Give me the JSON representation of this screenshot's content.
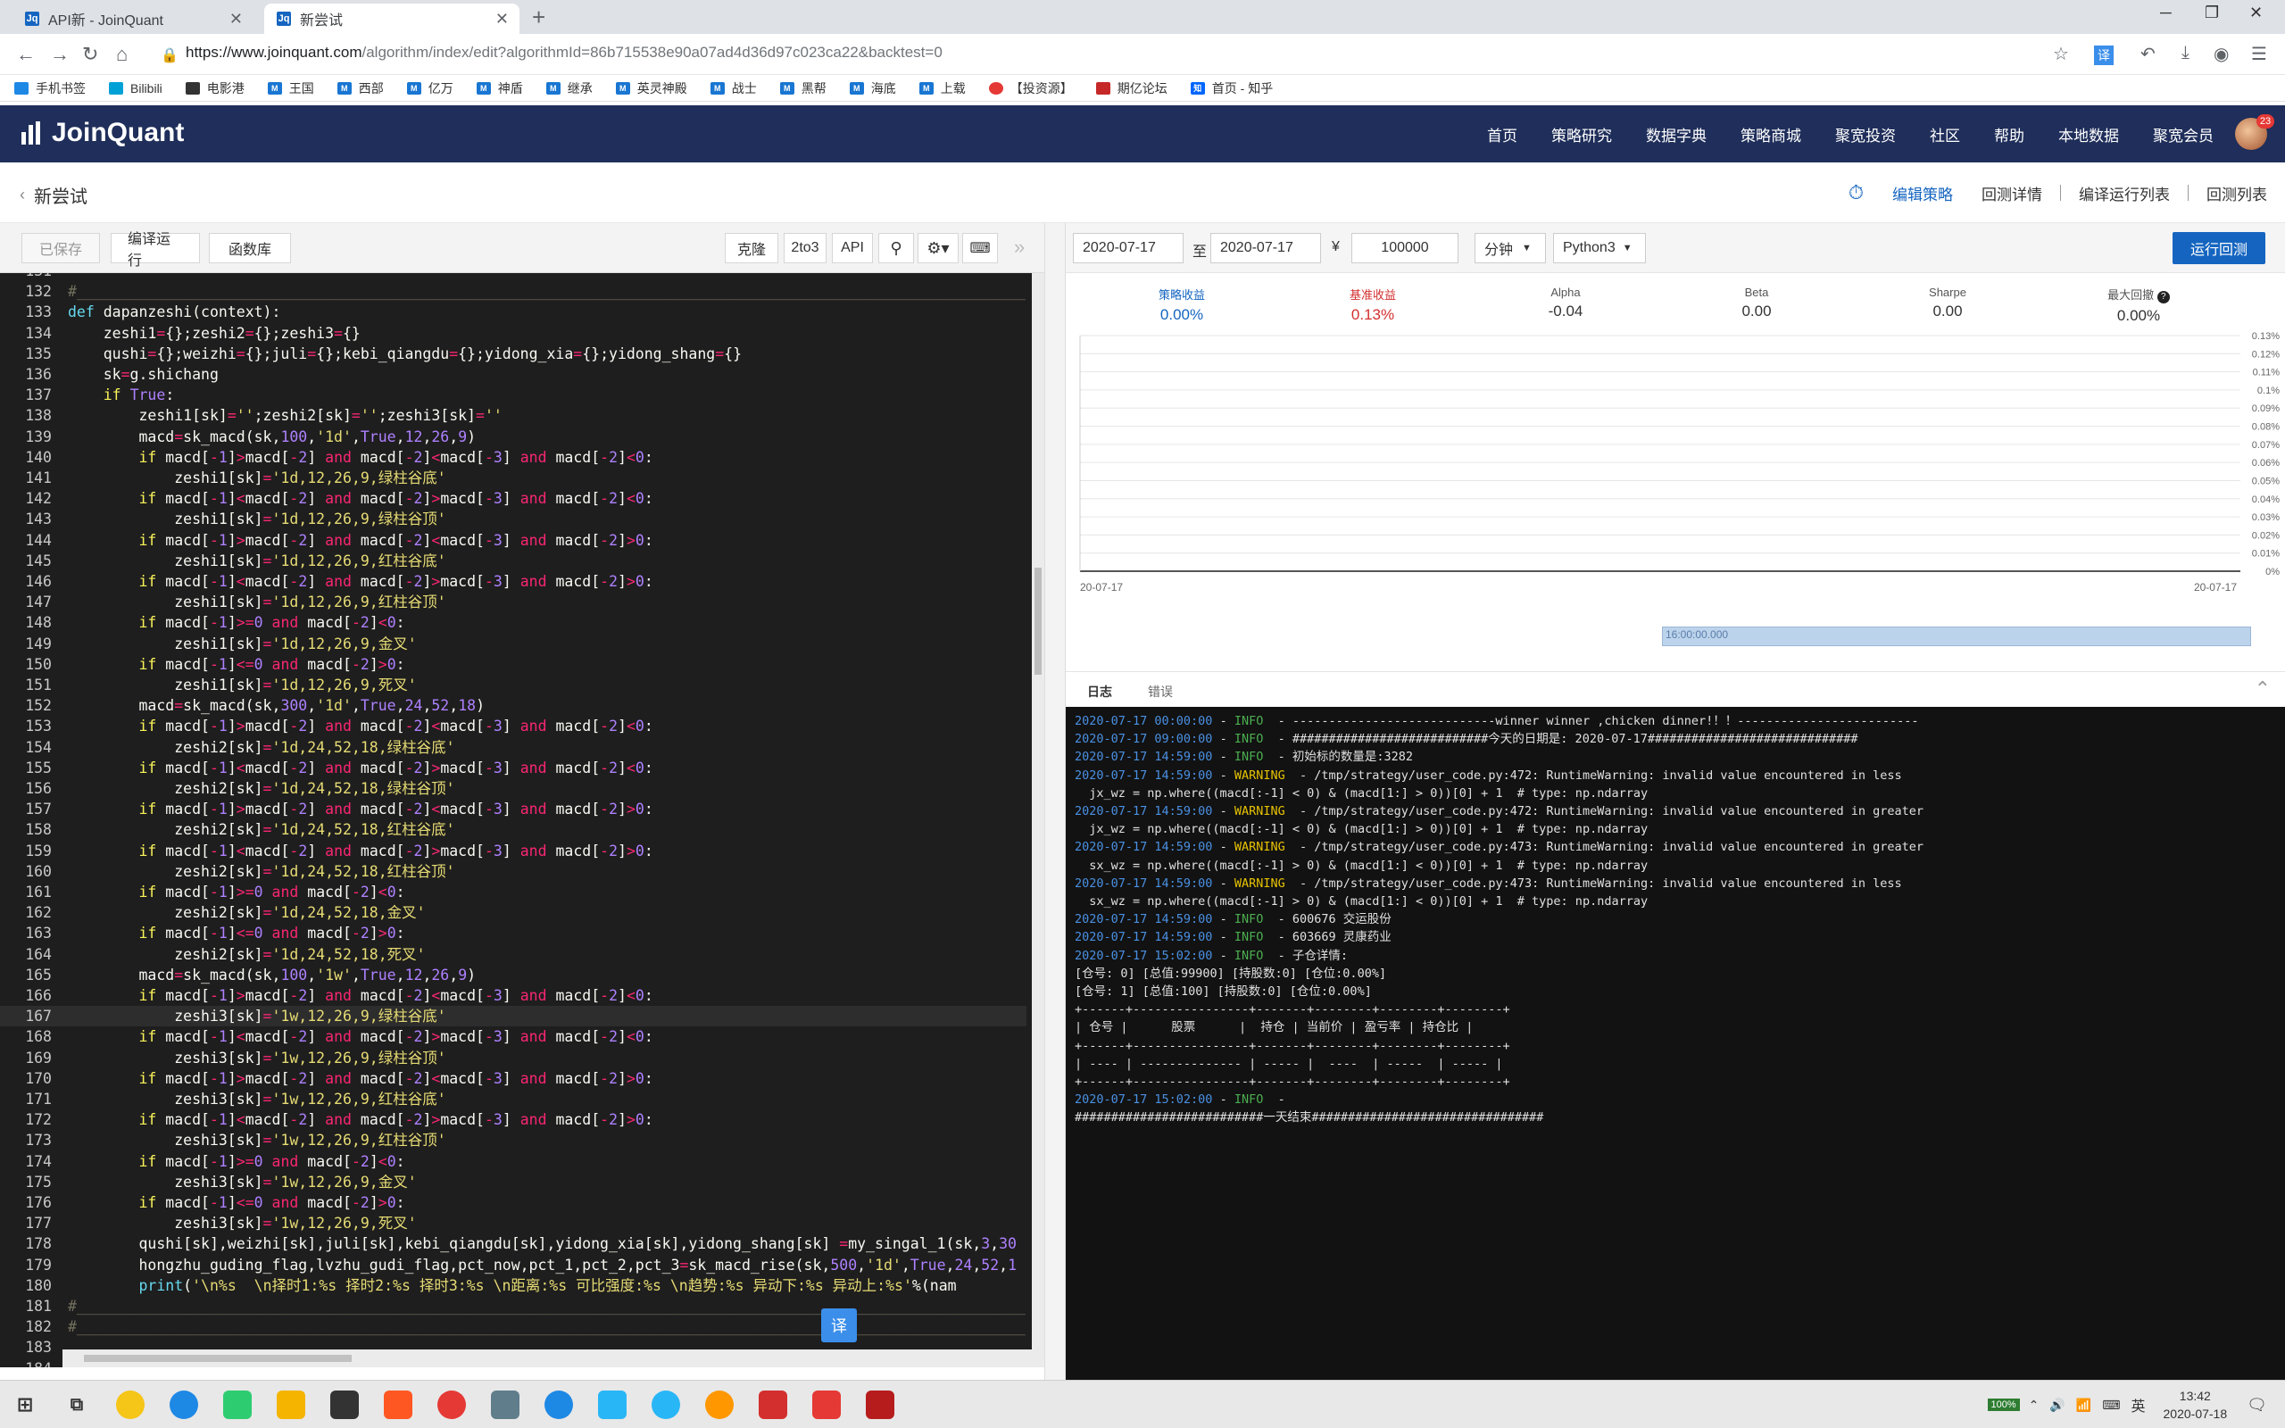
{
  "browser": {
    "tabs": [
      {
        "title": "API新 - JoinQuant",
        "favicon": "jq-icon",
        "active": false
      },
      {
        "title": "新尝试",
        "favicon": "jq-icon",
        "active": true
      }
    ],
    "url_host": "https://www.joinquant.com",
    "url_path": "/algorithm/index/edit?algorithmId=86b715538e90a07ad4d36d97c023ca22&backtest=0",
    "translate_label": "译",
    "bookmarks": [
      "手机书签",
      "Bilibili",
      "电影港",
      "王国",
      "西部",
      "亿万",
      "神盾",
      "继承",
      "英灵神殿",
      "战士",
      "黑帮",
      "海底",
      "上载",
      "【投资源】",
      "期亿论坛",
      "首页 - 知乎"
    ]
  },
  "site": {
    "brand": "JoinQuant",
    "nav": [
      "首页",
      "策略研究",
      "数据字典",
      "策略商城",
      "聚宽投资",
      "社区",
      "帮助",
      "本地数据",
      "聚宽会员"
    ],
    "avatar_badge": "23"
  },
  "strategy": {
    "name": "新尝试",
    "tabs": [
      {
        "label": "编辑策略",
        "active": true
      },
      {
        "label": "回测详情",
        "active": false
      },
      {
        "label": "编译运行列表",
        "active": false
      },
      {
        "label": "回测列表",
        "active": false
      }
    ]
  },
  "editor": {
    "toolbar": {
      "saved": "已保存",
      "compile_run": "编译运行",
      "function_lib": "函数库",
      "clone": "克隆",
      "to3": "2to3",
      "api": "API"
    },
    "current_line": 167,
    "translate_bubble": "译",
    "lines": [
      {
        "n": "131",
        "t": ""
      },
      {
        "n": "132",
        "t": "#___________________________________________________________________________________________________________"
      },
      {
        "n": "133",
        "t": "def dapanzeshi(context):"
      },
      {
        "n": "134",
        "t": "    zeshi1={};zeshi2={};zeshi3={}"
      },
      {
        "n": "135",
        "t": "    qushi={};weizhi={};juli={};kebi_qiangdu={};yidong_xia={};yidong_shang={}"
      },
      {
        "n": "136",
        "t": "    sk=g.shichang"
      },
      {
        "n": "137",
        "t": "    if True:"
      },
      {
        "n": "138",
        "t": "        zeshi1[sk]='';zeshi2[sk]='';zeshi3[sk]=''"
      },
      {
        "n": "139",
        "t": "        macd=sk_macd(sk,100,'1d',True,12,26,9)"
      },
      {
        "n": "140",
        "t": "        if macd[-1]>macd[-2] and macd[-2]<macd[-3] and macd[-2]<0:"
      },
      {
        "n": "141",
        "t": "            zeshi1[sk]='1d,12,26,9,绿柱谷底'"
      },
      {
        "n": "142",
        "t": "        if macd[-1]<macd[-2] and macd[-2]>macd[-3] and macd[-2]<0:"
      },
      {
        "n": "143",
        "t": "            zeshi1[sk]='1d,12,26,9,绿柱谷顶'"
      },
      {
        "n": "144",
        "t": "        if macd[-1]>macd[-2] and macd[-2]<macd[-3] and macd[-2]>0:"
      },
      {
        "n": "145",
        "t": "            zeshi1[sk]='1d,12,26,9,红柱谷底'"
      },
      {
        "n": "146",
        "t": "        if macd[-1]<macd[-2] and macd[-2]>macd[-3] and macd[-2]>0:"
      },
      {
        "n": "147",
        "t": "            zeshi1[sk]='1d,12,26,9,红柱谷顶'"
      },
      {
        "n": "148",
        "t": "        if macd[-1]>=0 and macd[-2]<0:"
      },
      {
        "n": "149",
        "t": "            zeshi1[sk]='1d,12,26,9,金叉'"
      },
      {
        "n": "150",
        "t": "        if macd[-1]<=0 and macd[-2]>0:"
      },
      {
        "n": "151",
        "t": "            zeshi1[sk]='1d,12,26,9,死叉'"
      },
      {
        "n": "152",
        "t": "        macd=sk_macd(sk,300,'1d',True,24,52,18)"
      },
      {
        "n": "153",
        "t": "        if macd[-1]>macd[-2] and macd[-2]<macd[-3] and macd[-2]<0:"
      },
      {
        "n": "154",
        "t": "            zeshi2[sk]='1d,24,52,18,绿柱谷底'"
      },
      {
        "n": "155",
        "t": "        if macd[-1]<macd[-2] and macd[-2]>macd[-3] and macd[-2]<0:"
      },
      {
        "n": "156",
        "t": "            zeshi2[sk]='1d,24,52,18,绿柱谷顶'"
      },
      {
        "n": "157",
        "t": "        if macd[-1]>macd[-2] and macd[-2]<macd[-3] and macd[-2]>0:"
      },
      {
        "n": "158",
        "t": "            zeshi2[sk]='1d,24,52,18,红柱谷底'"
      },
      {
        "n": "159",
        "t": "        if macd[-1]<macd[-2] and macd[-2]>macd[-3] and macd[-2]>0:"
      },
      {
        "n": "160",
        "t": "            zeshi2[sk]='1d,24,52,18,红柱谷顶'"
      },
      {
        "n": "161",
        "t": "        if macd[-1]>=0 and macd[-2]<0:"
      },
      {
        "n": "162",
        "t": "            zeshi2[sk]='1d,24,52,18,金叉'"
      },
      {
        "n": "163",
        "t": "        if macd[-1]<=0 and macd[-2]>0:"
      },
      {
        "n": "164",
        "t": "            zeshi2[sk]='1d,24,52,18,死叉'"
      },
      {
        "n": "165",
        "t": "        macd=sk_macd(sk,100,'1w',True,12,26,9)"
      },
      {
        "n": "166",
        "t": "        if macd[-1]>macd[-2] and macd[-2]<macd[-3] and macd[-2]<0:"
      },
      {
        "n": "167",
        "t": "            zeshi3[sk]='1w,12,26,9,绿柱谷底'"
      },
      {
        "n": "168",
        "t": "        if macd[-1]<macd[-2] and macd[-2]>macd[-3] and macd[-2]<0:"
      },
      {
        "n": "169",
        "t": "            zeshi3[sk]='1w,12,26,9,绿柱谷顶'"
      },
      {
        "n": "170",
        "t": "        if macd[-1]>macd[-2] and macd[-2]<macd[-3] and macd[-2]>0:"
      },
      {
        "n": "171",
        "t": "            zeshi3[sk]='1w,12,26,9,红柱谷底'"
      },
      {
        "n": "172",
        "t": "        if macd[-1]<macd[-2] and macd[-2]>macd[-3] and macd[-2]>0:"
      },
      {
        "n": "173",
        "t": "            zeshi3[sk]='1w,12,26,9,红柱谷顶'"
      },
      {
        "n": "174",
        "t": "        if macd[-1]>=0 and macd[-2]<0:"
      },
      {
        "n": "175",
        "t": "            zeshi3[sk]='1w,12,26,9,金叉'"
      },
      {
        "n": "176",
        "t": "        if macd[-1]<=0 and macd[-2]>0:"
      },
      {
        "n": "177",
        "t": "            zeshi3[sk]='1w,12,26,9,死叉'"
      },
      {
        "n": "178",
        "t": "        qushi[sk],weizhi[sk],juli[sk],kebi_qiangdu[sk],yidong_xia[sk],yidong_shang[sk] =my_singal_1(sk,3,30"
      },
      {
        "n": "179",
        "t": "        hongzhu_guding_flag,lvzhu_gudi_flag,pct_now,pct_1,pct_2,pct_3=sk_macd_rise(sk,500,'1d',True,24,52,1"
      },
      {
        "n": "180",
        "t": "        print('\\n%s  \\n择时1:%s 择时2:%s 择时3:%s \\n距离:%s 可比强度:%s \\n趋势:%s 异动下:%s 异动上:%s'%(nam"
      },
      {
        "n": "181",
        "t": "#___________________________________________________________________________________________________________"
      },
      {
        "n": "182",
        "t": "#___________________________________________________________________________________________________________"
      },
      {
        "n": "183",
        "t": ""
      },
      {
        "n": "184",
        "t": ""
      },
      {
        "n": "185",
        "t": ""
      }
    ]
  },
  "backtest": {
    "start_date": "2020-07-17",
    "to_label": "至",
    "end_date": "2020-07-17",
    "currency": "¥",
    "capital": "100000",
    "frequency": "分钟",
    "python": "Python3",
    "run_label": "运行回测",
    "metrics": [
      {
        "label": "策略收益",
        "value": "0.00%",
        "color": "blue"
      },
      {
        "label": "基准收益",
        "value": "0.13%",
        "color": "red"
      },
      {
        "label": "Alpha",
        "value": "-0.04",
        "color": "normal"
      },
      {
        "label": "Beta",
        "value": "0.00",
        "color": "normal"
      },
      {
        "label": "Sharpe",
        "value": "0.00",
        "color": "normal"
      },
      {
        "label": "最大回撤",
        "value": "0.00%",
        "color": "normal"
      }
    ],
    "slider_label": "16:00:00.000"
  },
  "chart_data": {
    "type": "line",
    "x": [
      "20-07-17",
      "20-07-17"
    ],
    "y_ticks": [
      "0.13%",
      "0.12%",
      "0.11%",
      "0.1%",
      "0.09%",
      "0.08%",
      "0.07%",
      "0.06%",
      "0.05%",
      "0.04%",
      "0.03%",
      "0.02%",
      "0.01%",
      "0%"
    ],
    "ylim": [
      0,
      0.13
    ],
    "grid": true
  },
  "logs": {
    "tabs": [
      {
        "label": "日志",
        "active": true
      },
      {
        "label": "错误",
        "active": false
      }
    ],
    "lines": [
      {
        "ts": "2020-07-17 00:00:00",
        "lv": "INFO",
        "msg": "----------------------------winner winner ,chicken dinner!！！-------------------------"
      },
      {
        "ts": "2020-07-17 09:00:00",
        "lv": "INFO",
        "msg": "###########################今天的日期是: 2020-07-17#############################"
      },
      {
        "ts": "2020-07-17 14:59:00",
        "lv": "INFO",
        "msg": "初始标的数量是:3282"
      },
      {
        "ts": "2020-07-17 14:59:00",
        "lv": "WARNING",
        "msg": "/tmp/strategy/user_code.py:472: RuntimeWarning: invalid value encountered in less"
      },
      {
        "ts": "",
        "lv": "",
        "msg": "  jx_wz = np.where((macd[:-1] < 0) & (macd[1:] > 0))[0] + 1  # type: np.ndarray"
      },
      {
        "ts": "2020-07-17 14:59:00",
        "lv": "WARNING",
        "msg": "/tmp/strategy/user_code.py:472: RuntimeWarning: invalid value encountered in greater"
      },
      {
        "ts": "",
        "lv": "",
        "msg": "  jx_wz = np.where((macd[:-1] < 0) & (macd[1:] > 0))[0] + 1  # type: np.ndarray"
      },
      {
        "ts": "2020-07-17 14:59:00",
        "lv": "WARNING",
        "msg": "/tmp/strategy/user_code.py:473: RuntimeWarning: invalid value encountered in greater"
      },
      {
        "ts": "",
        "lv": "",
        "msg": "  sx_wz = np.where((macd[:-1] > 0) & (macd[1:] < 0))[0] + 1  # type: np.ndarray"
      },
      {
        "ts": "2020-07-17 14:59:00",
        "lv": "WARNING",
        "msg": "/tmp/strategy/user_code.py:473: RuntimeWarning: invalid value encountered in less"
      },
      {
        "ts": "",
        "lv": "",
        "msg": "  sx_wz = np.where((macd[:-1] > 0) & (macd[1:] < 0))[0] + 1  # type: np.ndarray"
      },
      {
        "ts": "2020-07-17 14:59:00",
        "lv": "INFO",
        "msg": "600676 交运股份"
      },
      {
        "ts": "2020-07-17 14:59:00",
        "lv": "INFO",
        "msg": "603669 灵康药业"
      },
      {
        "ts": "2020-07-17 15:02:00",
        "lv": "INFO",
        "msg": "子仓详情:"
      },
      {
        "ts": "",
        "lv": "",
        "msg": "[仓号: 0] [总值:99900] [持股数:0] [仓位:0.00%]"
      },
      {
        "ts": "",
        "lv": "",
        "msg": "[仓号: 1] [总值:100] [持股数:0] [仓位:0.00%]"
      },
      {
        "ts": "",
        "lv": "",
        "msg": "+------+----------------+-------+--------+--------+--------+"
      },
      {
        "ts": "",
        "lv": "",
        "msg": "| 仓号 |      股票      |  持仓 | 当前价 | 盈亏率 | 持仓比 |"
      },
      {
        "ts": "",
        "lv": "",
        "msg": "+------+----------------+-------+--------+--------+--------+"
      },
      {
        "ts": "",
        "lv": "",
        "msg": "| ---- | -------------- | ----- |  ----  | -----  | ----- |"
      },
      {
        "ts": "",
        "lv": "",
        "msg": "+------+----------------+-------+--------+--------+--------+"
      },
      {
        "ts": "2020-07-17 15:02:00",
        "lv": "INFO",
        "msg": ""
      },
      {
        "ts": "",
        "lv": "",
        "msg": "##########################一天结束################################"
      }
    ]
  },
  "taskbar": {
    "battery": "100%",
    "ime": "英",
    "time": "13:42",
    "date": "2020-07-18"
  }
}
